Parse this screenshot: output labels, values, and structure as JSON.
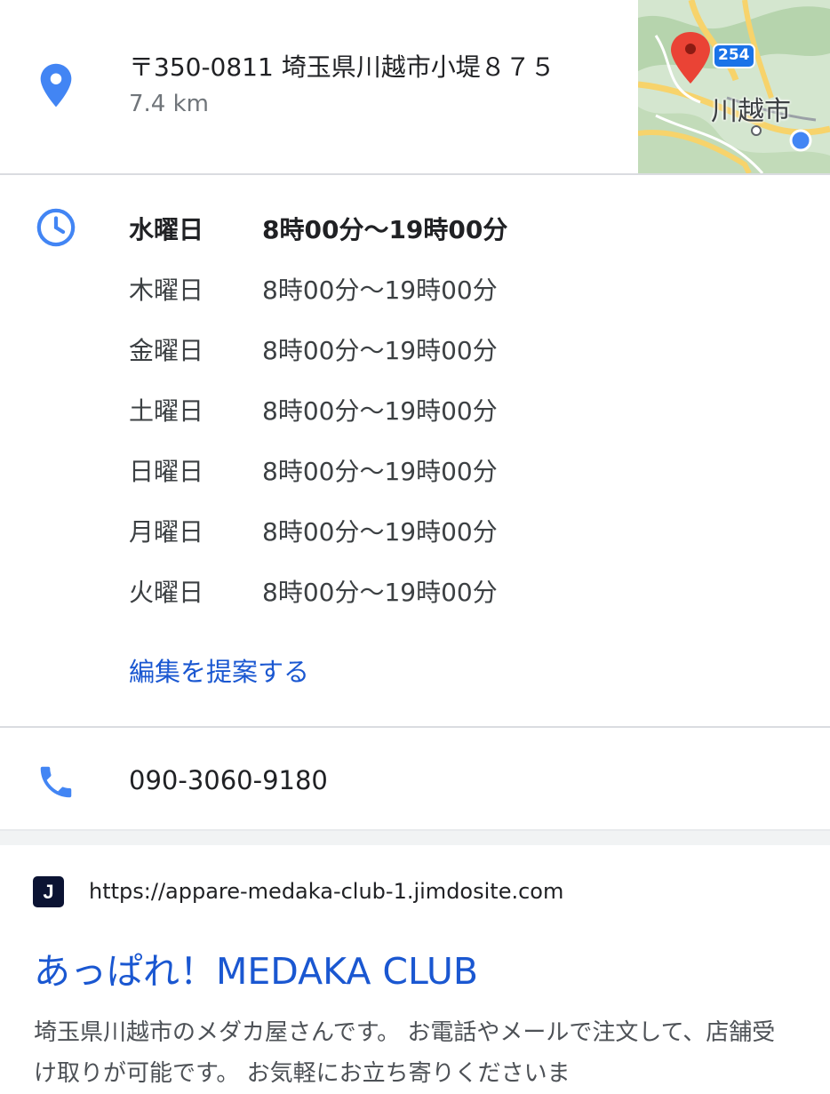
{
  "address": {
    "icon": "location-pin-icon",
    "line": "〒350-0811 埼玉県川越市小堤８７５",
    "distance": "7.4 km",
    "map": {
      "city_label": "川越市",
      "route_number": "254"
    }
  },
  "hours": {
    "icon": "clock-icon",
    "rows": [
      {
        "day": "水曜日",
        "time": "8時00分〜19時00分",
        "today": true
      },
      {
        "day": "木曜日",
        "time": "8時00分〜19時00分"
      },
      {
        "day": "金曜日",
        "time": "8時00分〜19時00分"
      },
      {
        "day": "土曜日",
        "time": "8時00分〜19時00分"
      },
      {
        "day": "日曜日",
        "time": "8時00分〜19時00分"
      },
      {
        "day": "月曜日",
        "time": "8時00分〜19時00分"
      },
      {
        "day": "火曜日",
        "time": "8時00分〜19時00分"
      }
    ],
    "suggest_edit": "編集を提案する"
  },
  "phone": {
    "icon": "phone-icon",
    "number": "090-3060-9180"
  },
  "result": {
    "favicon_letter": "J",
    "url": "https://appare-medaka-club-1.jimdosite.com",
    "title": "あっぱれ！MEDAKA CLUB",
    "snippet": "埼玉県川越市のメダカ屋さんです。 お電話やメールで注文して、店舗受け取りが可能です。 お気軽にお立ち寄りくださいま"
  },
  "colors": {
    "link": "#1a57d1",
    "icon_blue": "#4285f4",
    "pin_red": "#ea4335",
    "divider": "#dadce0"
  }
}
